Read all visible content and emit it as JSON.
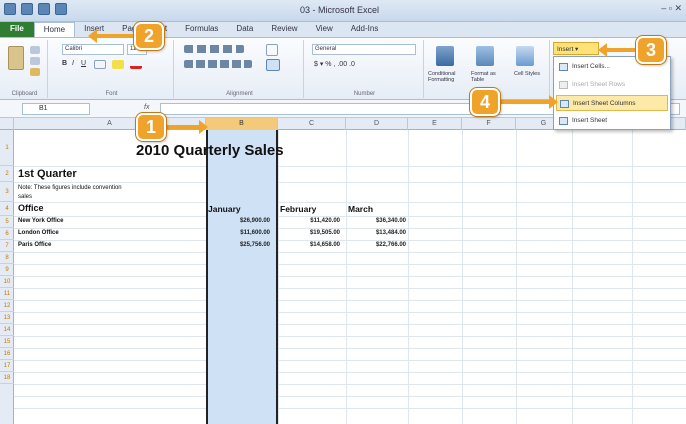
{
  "window": {
    "title": "03 - Microsoft Excel",
    "controls": "‒ ▫ ✕"
  },
  "tabs": [
    "File",
    "Home",
    "Insert",
    "Page Layout",
    "Formulas",
    "Data",
    "Review",
    "View",
    "Add-Ins"
  ],
  "ribbon": {
    "clipboard_label": "Clipboard",
    "font_label": "Font",
    "font_name": "Calibri",
    "font_size": "11",
    "alignment_label": "Alignment",
    "number_label": "Number",
    "number_format": "General",
    "number_controls": "$ ▾ % , .00 .0",
    "conditional_formatting": "Conditional Formatting",
    "format_as_table": "Format as Table",
    "cell_styles": "Cell Styles",
    "insert_button": "Insert ▾"
  },
  "insert_menu": [
    {
      "label": "Insert Cells...",
      "enabled": true
    },
    {
      "label": "Insert Sheet Rows",
      "enabled": false
    },
    {
      "label": "Insert Sheet Columns",
      "enabled": true,
      "highlighted": true
    },
    {
      "label": "Insert Sheet",
      "enabled": true
    }
  ],
  "formula_bar": {
    "name_box": "B1",
    "fx": "fx",
    "value": ""
  },
  "columns": [
    "A",
    "B",
    "C",
    "D",
    "E",
    "F",
    "G",
    "H",
    "I"
  ],
  "selected_column": "B",
  "rows": [
    "1",
    "2",
    "3",
    "4",
    "5",
    "6",
    "7",
    "8",
    "9",
    "10",
    "11",
    "12",
    "13",
    "14",
    "15",
    "16",
    "17",
    "18"
  ],
  "sheet": {
    "title": "2010 Quarterly Sales",
    "quarter": "1st Quarter",
    "note_line1": "Note: These figures include convention",
    "note_line2": "sales",
    "office_header": "Office",
    "months": [
      "January",
      "February",
      "March"
    ],
    "offices": [
      {
        "name": "New York Office",
        "values": [
          "$26,900.00",
          "$11,420.00",
          "$36,340.00"
        ]
      },
      {
        "name": "London Office",
        "values": [
          "$11,600.00",
          "$19,505.00",
          "$13,484.00"
        ]
      },
      {
        "name": "Paris Office",
        "values": [
          "$25,756.00",
          "$14,658.00",
          "$22,766.00"
        ]
      }
    ]
  },
  "callouts": [
    "1",
    "2",
    "3",
    "4"
  ],
  "colors": {
    "accent": "#f0a32a",
    "selection": "#cfe1f4",
    "file_tab": "#2e7d32"
  }
}
